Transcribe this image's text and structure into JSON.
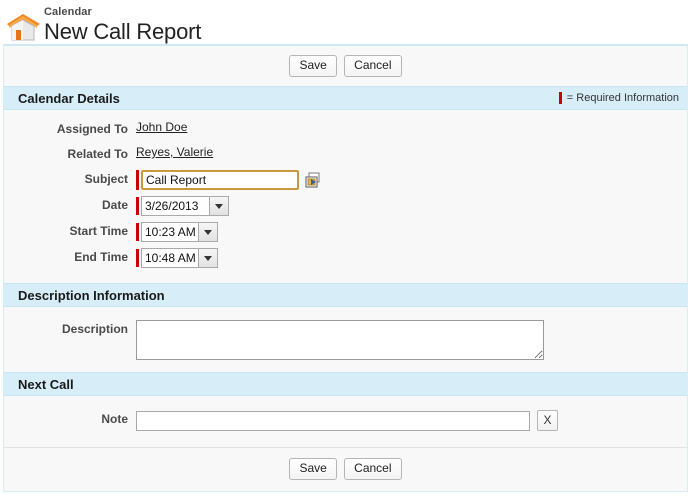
{
  "header": {
    "icon": "home-icon",
    "breadcrumb": "Calendar",
    "title": "New Call Report"
  },
  "toolbar_top": {
    "save_label": "Save",
    "cancel_label": "Cancel"
  },
  "toolbar_bottom": {
    "save_label": "Save",
    "cancel_label": "Cancel"
  },
  "sections": {
    "calendar_details": {
      "title": "Calendar Details",
      "required_legend": "= Required Information",
      "fields": {
        "assigned_to": {
          "label": "Assigned To",
          "value": "John Doe"
        },
        "related_to": {
          "label": "Related To",
          "value": "Reyes, Valerie"
        },
        "subject": {
          "label": "Subject",
          "value": "Call Report",
          "placeholder": "",
          "lookup_icon": "lookup-picker-icon"
        },
        "date": {
          "label": "Date",
          "value": "3/26/2013",
          "dropdown_icon": "chevron-down-icon"
        },
        "start_time": {
          "label": "Start Time",
          "value": "10:23 AM",
          "dropdown_icon": "chevron-down-icon"
        },
        "end_time": {
          "label": "End Time",
          "value": "10:48 AM",
          "dropdown_icon": "chevron-down-icon"
        }
      }
    },
    "description_information": {
      "title": "Description Information",
      "fields": {
        "description": {
          "label": "Description",
          "value": "",
          "placeholder": ""
        }
      }
    },
    "next_call": {
      "title": "Next Call",
      "fields": {
        "note": {
          "label": "Note",
          "value": "",
          "placeholder": "",
          "clear_label": "X"
        }
      }
    }
  },
  "colors": {
    "section_header_bg": "#d7eef8",
    "required_red": "#cc0000",
    "panel_bg": "#f8f8f8",
    "focus_border": "#c89b3c",
    "roof_orange": "#f28c28"
  }
}
